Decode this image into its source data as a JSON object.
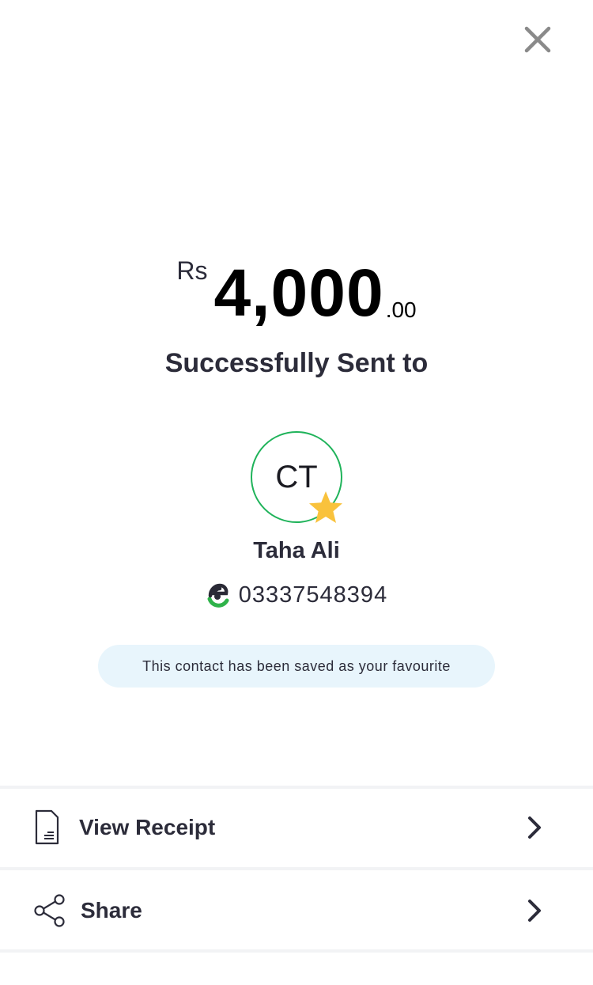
{
  "header": {
    "close_icon": "close-icon"
  },
  "transaction": {
    "currency": "Rs",
    "amount_main": "4,000",
    "amount_cents": ".00",
    "status_text": "Successfully Sent to"
  },
  "recipient": {
    "initials": "CT",
    "name": "Taha Ali",
    "phone": "03337548394",
    "favourite_icon": "star-icon",
    "wallet_icon": "easypaisa-logo-icon",
    "favourite_message": "This contact has been saved as your favourite"
  },
  "actions": [
    {
      "label": "View Receipt",
      "icon": "receipt-icon"
    },
    {
      "label": "Share",
      "icon": "share-icon"
    }
  ],
  "colors": {
    "avatar_ring": "#1fb35a",
    "star": "#f9c23c",
    "banner_bg": "#e8f5fc",
    "text_dark": "#2c2c3a"
  }
}
